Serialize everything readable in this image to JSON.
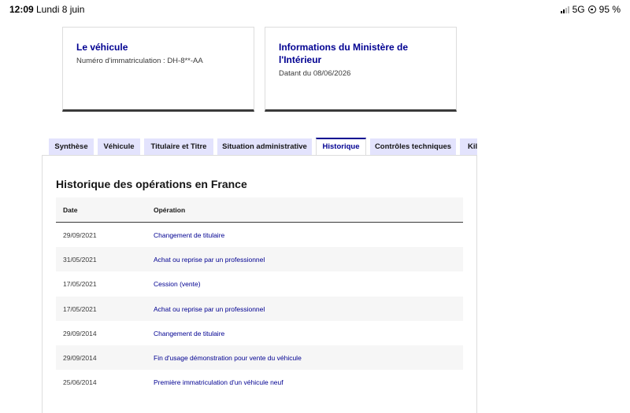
{
  "status_bar": {
    "time": "12:09",
    "date": "Lundi 8 juin",
    "network": "5G",
    "battery": "95 %"
  },
  "cards": {
    "vehicle": {
      "title": "Le véhicule",
      "subtitle": "Numéro d'immatriculation : DH-8**-AA"
    },
    "ministry": {
      "title_line1": "Informations du Ministère de",
      "title_line2": "l'Intérieur",
      "subtitle": "Datant du 08/06/2026"
    }
  },
  "tabs": [
    {
      "label": "Synthèse"
    },
    {
      "label": "Véhicule"
    },
    {
      "label": "Titulaire et Titre"
    },
    {
      "label": "Situation administrative"
    },
    {
      "label": "Historique"
    },
    {
      "label": "Contrôles techniques"
    },
    {
      "label": "Kilo"
    }
  ],
  "active_tab": "Historique",
  "section": {
    "title": "Historique des opérations en France"
  },
  "table": {
    "headers": {
      "date": "Date",
      "operation": "Opération"
    },
    "rows": [
      {
        "date": "29/09/2021",
        "operation": "Changement de titulaire"
      },
      {
        "date": "31/05/2021",
        "operation": "Achat ou reprise par un professionnel"
      },
      {
        "date": "17/05/2021",
        "operation": "Cession (vente)"
      },
      {
        "date": "17/05/2021",
        "operation": "Achat ou reprise par un professionnel"
      },
      {
        "date": "29/09/2014",
        "operation": "Changement de titulaire"
      },
      {
        "date": "29/09/2014",
        "operation": "Fin d'usage démonstration pour vente du véhicule"
      },
      {
        "date": "25/06/2014",
        "operation": "Première immatriculation d'un véhicule neuf"
      }
    ]
  },
  "colors": {
    "accent_blue": "#000091",
    "tab_bg": "#e3e3fd",
    "row_alt": "#f6f6f6"
  }
}
